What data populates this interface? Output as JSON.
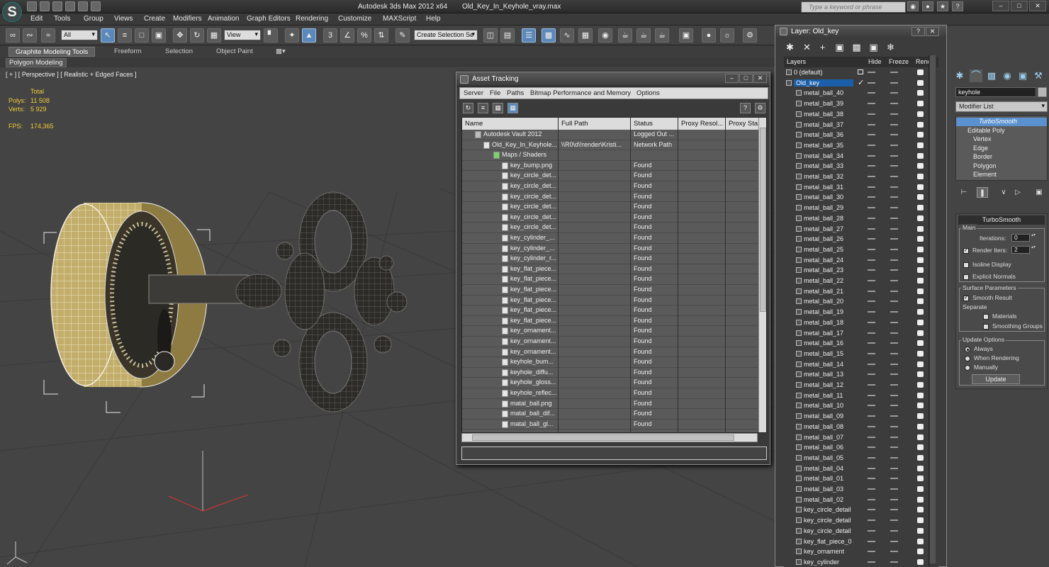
{
  "app": {
    "title": "Autodesk 3ds Max  2012 x64",
    "file": "Old_Key_In_Keyhole_vray.max",
    "logo": "S",
    "search_placeholder": "Type a keyword or phrase"
  },
  "menu": [
    "Edit",
    "Tools",
    "Group",
    "Views",
    "Create",
    "Modifiers",
    "Animation",
    "Graph Editors",
    "Rendering",
    "Customize",
    "MAXScript",
    "Help"
  ],
  "toolbar": {
    "filter": "All",
    "coord": "View",
    "selset": "Create Selection Se"
  },
  "ribbon": {
    "tabs": [
      "Graphite Modeling Tools",
      "Freeform",
      "Selection",
      "Object Paint"
    ],
    "active": 0,
    "panel": "Polygon Modeling"
  },
  "viewport": {
    "label": "[ + ] [ Perspective ] [ Realistic + Edged Faces ]",
    "stats": {
      "total_label": "Total",
      "polys_label": "Polys:",
      "polys": "11 508",
      "verts_label": "Verts:",
      "verts": "5 929",
      "fps_label": "FPS:",
      "fps": "174,365"
    }
  },
  "asset_tracking": {
    "title": "Asset Tracking",
    "menu": [
      "Server",
      "File",
      "Paths",
      "Bitmap Performance and Memory",
      "Options"
    ],
    "columns": [
      "Name",
      "Full Path",
      "Status",
      "Proxy Resol...",
      "Proxy Sta"
    ],
    "rows": [
      {
        "name": "Autodesk Vault 2012",
        "path": "",
        "status": "Logged Out ...",
        "indent": 0,
        "icon": "vault-icon"
      },
      {
        "name": "Old_Key_In_Keyhole...",
        "path": "\\\\R0\\d\\!render\\Kristi...",
        "status": "Network Path",
        "indent": 1,
        "icon": "max-file-icon"
      },
      {
        "name": "Maps / Shaders",
        "path": "",
        "status": "",
        "indent": 2,
        "icon": "maps-icon"
      },
      {
        "name": "key_bump.png",
        "path": "",
        "status": "Found",
        "indent": 3,
        "icon": "image-file-icon"
      },
      {
        "name": "key_circle_det...",
        "path": "",
        "status": "Found",
        "indent": 3,
        "icon": "image-file-icon"
      },
      {
        "name": "key_circle_det...",
        "path": "",
        "status": "Found",
        "indent": 3,
        "icon": "image-file-icon"
      },
      {
        "name": "key_circle_det...",
        "path": "",
        "status": "Found",
        "indent": 3,
        "icon": "image-file-icon"
      },
      {
        "name": "key_circle_det...",
        "path": "",
        "status": "Found",
        "indent": 3,
        "icon": "image-file-icon"
      },
      {
        "name": "key_circle_det...",
        "path": "",
        "status": "Found",
        "indent": 3,
        "icon": "image-file-icon"
      },
      {
        "name": "key_circle_det...",
        "path": "",
        "status": "Found",
        "indent": 3,
        "icon": "image-file-icon"
      },
      {
        "name": "key_cylinder_...",
        "path": "",
        "status": "Found",
        "indent": 3,
        "icon": "image-file-icon"
      },
      {
        "name": "key_cylinder_...",
        "path": "",
        "status": "Found",
        "indent": 3,
        "icon": "image-file-icon"
      },
      {
        "name": "key_cylinder_r...",
        "path": "",
        "status": "Found",
        "indent": 3,
        "icon": "image-file-icon"
      },
      {
        "name": "key_flat_piece...",
        "path": "",
        "status": "Found",
        "indent": 3,
        "icon": "image-file-icon"
      },
      {
        "name": "key_flat_piece...",
        "path": "",
        "status": "Found",
        "indent": 3,
        "icon": "image-file-icon"
      },
      {
        "name": "key_flat_piece...",
        "path": "",
        "status": "Found",
        "indent": 3,
        "icon": "image-file-icon"
      },
      {
        "name": "key_flat_piece...",
        "path": "",
        "status": "Found",
        "indent": 3,
        "icon": "image-file-icon"
      },
      {
        "name": "key_flat_piece...",
        "path": "",
        "status": "Found",
        "indent": 3,
        "icon": "image-file-icon"
      },
      {
        "name": "key_flat_piece...",
        "path": "",
        "status": "Found",
        "indent": 3,
        "icon": "image-file-icon"
      },
      {
        "name": "key_ornament...",
        "path": "",
        "status": "Found",
        "indent": 3,
        "icon": "image-file-icon"
      },
      {
        "name": "key_ornament...",
        "path": "",
        "status": "Found",
        "indent": 3,
        "icon": "image-file-icon"
      },
      {
        "name": "key_ornament...",
        "path": "",
        "status": "Found",
        "indent": 3,
        "icon": "image-file-icon"
      },
      {
        "name": "keyhole_bum...",
        "path": "",
        "status": "Found",
        "indent": 3,
        "icon": "image-file-icon"
      },
      {
        "name": "keyhole_diffu...",
        "path": "",
        "status": "Found",
        "indent": 3,
        "icon": "image-file-icon"
      },
      {
        "name": "keyhole_gloss...",
        "path": "",
        "status": "Found",
        "indent": 3,
        "icon": "image-file-icon"
      },
      {
        "name": "keyhole_reflec...",
        "path": "",
        "status": "Found",
        "indent": 3,
        "icon": "image-file-icon"
      },
      {
        "name": "matal_ball.png",
        "path": "",
        "status": "Found",
        "indent": 3,
        "icon": "image-file-icon"
      },
      {
        "name": "matal_ball_dif...",
        "path": "",
        "status": "Found",
        "indent": 3,
        "icon": "image-file-icon"
      },
      {
        "name": "matal_ball_gl...",
        "path": "",
        "status": "Found",
        "indent": 3,
        "icon": "image-file-icon"
      }
    ]
  },
  "layers": {
    "title": "Layer: Old_key",
    "columns": [
      "Layers",
      "Hide",
      "Freeze",
      "Rend"
    ],
    "rows": [
      {
        "name": "0 (default)",
        "kind": "layer",
        "check": false,
        "box": true
      },
      {
        "name": "Old_key",
        "kind": "layer",
        "check": true,
        "selected": true
      },
      {
        "name": "metal_ball_40"
      },
      {
        "name": "metal_ball_39"
      },
      {
        "name": "metal_ball_38"
      },
      {
        "name": "metal_ball_37"
      },
      {
        "name": "metal_ball_36"
      },
      {
        "name": "metal_ball_35"
      },
      {
        "name": "metal_ball_34"
      },
      {
        "name": "metal_ball_33"
      },
      {
        "name": "metal_ball_32"
      },
      {
        "name": "metal_ball_31"
      },
      {
        "name": "metal_ball_30"
      },
      {
        "name": "metal_ball_29"
      },
      {
        "name": "metal_ball_28"
      },
      {
        "name": "metal_ball_27"
      },
      {
        "name": "metal_ball_26"
      },
      {
        "name": "metal_ball_25"
      },
      {
        "name": "metal_ball_24"
      },
      {
        "name": "metal_ball_23"
      },
      {
        "name": "metal_ball_22"
      },
      {
        "name": "metal_ball_21"
      },
      {
        "name": "metal_ball_20"
      },
      {
        "name": "metal_ball_19"
      },
      {
        "name": "metal_ball_18"
      },
      {
        "name": "metal_ball_17"
      },
      {
        "name": "metal_ball_16"
      },
      {
        "name": "metal_ball_15"
      },
      {
        "name": "metal_ball_14"
      },
      {
        "name": "metal_ball_13"
      },
      {
        "name": "metal_ball_12"
      },
      {
        "name": "metal_ball_11"
      },
      {
        "name": "metal_ball_10"
      },
      {
        "name": "metal_ball_09"
      },
      {
        "name": "metal_ball_08"
      },
      {
        "name": "metal_ball_07"
      },
      {
        "name": "metal_ball_06"
      },
      {
        "name": "metal_ball_05"
      },
      {
        "name": "metal_ball_04"
      },
      {
        "name": "metal_ball_01"
      },
      {
        "name": "metal_ball_03"
      },
      {
        "name": "metal_ball_02"
      },
      {
        "name": "key_circle_detail"
      },
      {
        "name": "key_circle_detail"
      },
      {
        "name": "key_circle_detail"
      },
      {
        "name": "key_flat_piece_0"
      },
      {
        "name": "key_ornament"
      },
      {
        "name": "key_cylinder"
      }
    ]
  },
  "command_panel": {
    "object_name": "keyhole",
    "modifier_list": "Modifier List",
    "stack": [
      {
        "label": "TurboSmooth",
        "level": 0,
        "highlight": true
      },
      {
        "label": "Editable Poly",
        "level": 0
      },
      {
        "label": "Vertex",
        "level": 1
      },
      {
        "label": "Edge",
        "level": 1
      },
      {
        "label": "Border",
        "level": 1
      },
      {
        "label": "Polygon",
        "level": 1
      },
      {
        "label": "Element",
        "level": 1
      }
    ],
    "turbosmooth": {
      "title": "TurboSmooth",
      "main_label": "Main",
      "iterations_label": "Iterations:",
      "iterations": "0",
      "render_iters_label": "Render Iters:",
      "render_iters": "2",
      "render_iters_checked": true,
      "isoline_label": "Isoline Display",
      "isoline_checked": false,
      "explicit_label": "Explicit Normals",
      "explicit_checked": false,
      "surface_label": "Surface Parameters",
      "smooth_result_label": "Smooth Result",
      "smooth_result_checked": true,
      "separate_label": "Separate",
      "materials_label": "Materials",
      "smoothing_groups_label": "Smoothing Groups",
      "update_label": "Update Options",
      "always_label": "Always",
      "when_rendering_label": "When Rendering",
      "manually_label": "Manually",
      "update_mode": "Always",
      "update_button": "Update"
    }
  }
}
